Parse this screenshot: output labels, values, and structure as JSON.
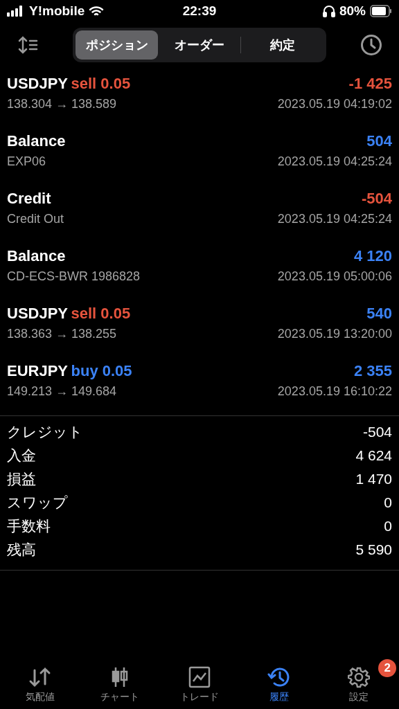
{
  "status_bar": {
    "carrier": "Y!mobile",
    "time": "22:39",
    "battery": "80%"
  },
  "segments": [
    {
      "label": "ポジション",
      "selected": true
    },
    {
      "label": "オーダー",
      "selected": false
    },
    {
      "label": "約定",
      "selected": false
    }
  ],
  "deals": [
    {
      "title": "USDJPY",
      "action": {
        "text": "sell 0.05",
        "kind": "sell"
      },
      "detail": "138.304 → 138.589",
      "amount": "-1 425",
      "color": "#e5533d",
      "time": "2023.05.19 04:19:02"
    },
    {
      "title": "Balance",
      "detail": "EXP06",
      "amount": "504",
      "color": "#3b82f6",
      "time": "2023.05.19 04:25:24"
    },
    {
      "title": "Credit",
      "detail": "Credit Out",
      "amount": "-504",
      "color": "#e5533d",
      "time": "2023.05.19 04:25:24"
    },
    {
      "title": "Balance",
      "detail": "CD-ECS-BWR 1986828",
      "amount": "4 120",
      "color": "#3b82f6",
      "time": "2023.05.19 05:00:06"
    },
    {
      "title": "USDJPY",
      "action": {
        "text": "sell 0.05",
        "kind": "sell"
      },
      "detail": "138.363 → 138.255",
      "amount": "540",
      "color": "#3b82f6",
      "time": "2023.05.19 13:20:00"
    },
    {
      "title": "EURJPY",
      "action": {
        "text": "buy 0.05",
        "kind": "buy"
      },
      "detail": "149.213 → 149.684",
      "amount": "2 355",
      "color": "#3b82f6",
      "time": "2023.05.19 16:10:22"
    }
  ],
  "summary": [
    {
      "label": "クレジット",
      "value": "-504"
    },
    {
      "label": "入金",
      "value": "4 624"
    },
    {
      "label": "損益",
      "value": "1 470"
    },
    {
      "label": "スワップ",
      "value": "0"
    },
    {
      "label": "手数料",
      "value": "0"
    },
    {
      "label": "残高",
      "value": "5 590"
    }
  ],
  "tab_bar": [
    {
      "label": "気配値",
      "kind": "quotes",
      "selected": false
    },
    {
      "label": "チャート",
      "kind": "chart",
      "selected": false
    },
    {
      "label": "トレード",
      "kind": "trade",
      "selected": false
    },
    {
      "label": "履歴",
      "kind": "history",
      "selected": true
    },
    {
      "label": "設定",
      "kind": "settings",
      "selected": false,
      "badge": "2"
    }
  ]
}
